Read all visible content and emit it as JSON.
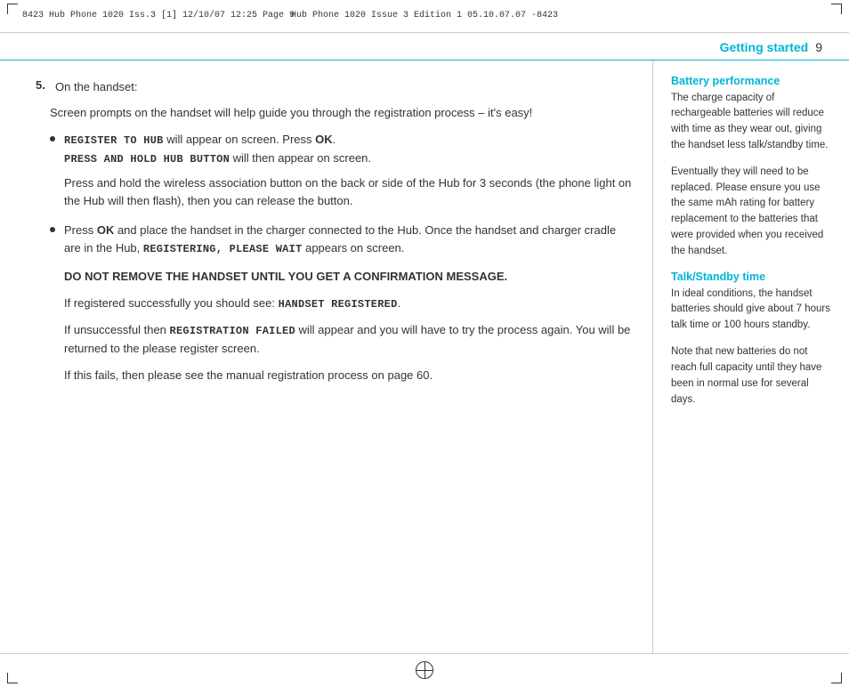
{
  "header": {
    "left_text": "8423 Hub Phone 1020 Iss.3 [1]   12/10/07  12:25  Page 9",
    "center_text": "Hub Phone 1020  Issue 3  Edition 1  05.10.07.07  ·8423"
  },
  "page_title": {
    "label": "Getting started",
    "page_number": "9"
  },
  "main": {
    "step_number": "5.",
    "step_intro": "On the handset:",
    "para1": "Screen prompts on the handset will help guide you through the registration process – it's easy!",
    "bullet1": {
      "line1_mono": "REGISTER TO HUB",
      "line1_rest": " will appear on screen. Press ",
      "line1_ok": "OK",
      "line1_end": ".",
      "line2_mono": "PRESS AND HOLD HUB BUTTON",
      "line2_rest": " will then appear on screen."
    },
    "bullet1_extra": "Press and hold the wireless association button on the back or side of the Hub for 3 seconds (the phone light on the Hub will then flash), then you can release the button.",
    "bullet2": {
      "line1_pre": "Press ",
      "line1_ok": "OK",
      "line1_rest": " and place the handset in the charger connected to the Hub. Once the handset and charger cradle are in the Hub, ",
      "line1_mono": "REGISTERING, PLEASE WAIT",
      "line1_end": " appears on screen."
    },
    "warning": "DO NOT REMOVE THE HANDSET UNTIL YOU GET A CONFIRMATION MESSAGE.",
    "para2_pre": "If registered successfully you should see: ",
    "para2_mono": "HANDSET REGISTERED",
    "para2_end": ".",
    "para3_pre": "If unsuccessful then ",
    "para3_mono": "REGISTRATION FAILED",
    "para3_rest": " will appear and you will have to try the process again. You will be returned to the please register screen.",
    "para4": "If this fails, then please see the manual registration process on page 60."
  },
  "sidebar": {
    "section1": {
      "heading": "Battery performance",
      "text1": "The charge capacity of rechargeable batteries will reduce with time as they wear out, giving the handset less talk/standby time.",
      "text2": "Eventually they will need to be replaced. Please ensure you use the same mAh rating for battery replacement to the batteries that were provided when you received the handset."
    },
    "section2": {
      "heading": "Talk/Standby time",
      "text1": "In ideal conditions, the handset batteries should give about 7 hours talk time or 100 hours standby.",
      "text2": "Note that new batteries do not reach full capacity until they have been in normal use for several days."
    }
  }
}
